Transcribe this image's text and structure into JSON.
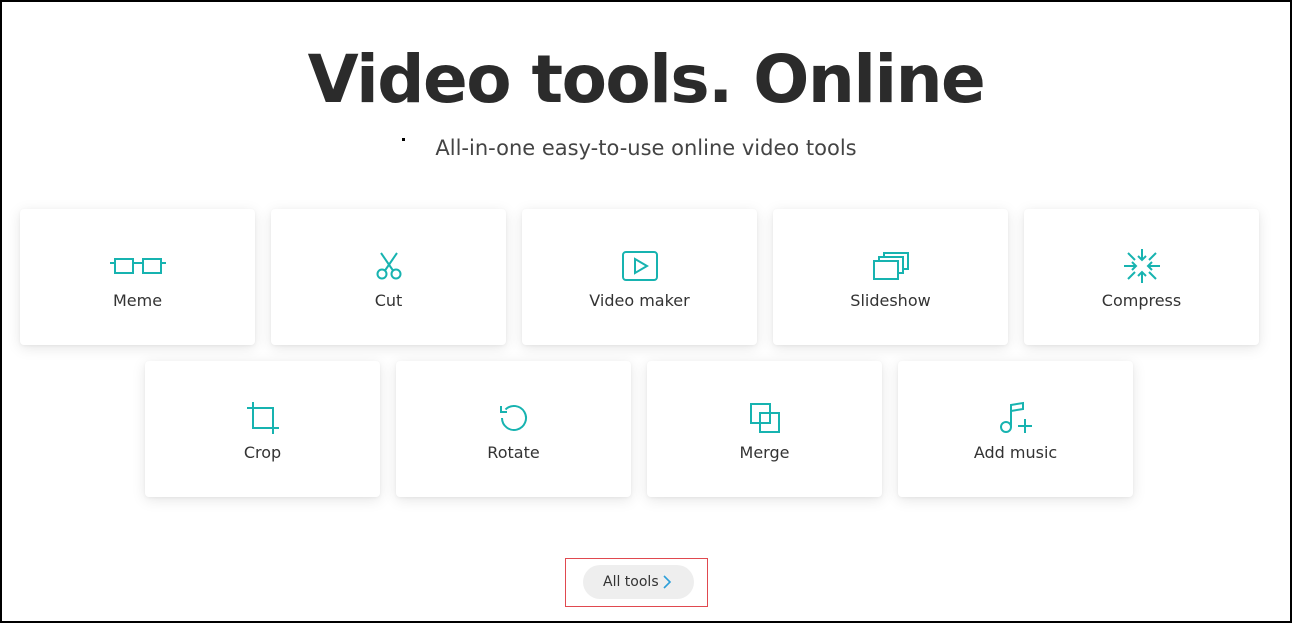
{
  "hero": {
    "title": "Video tools. Online",
    "subtitle": "All-in-one easy-to-use online video tools"
  },
  "tools_row_1": [
    {
      "label": "Meme",
      "icon": "glasses-icon"
    },
    {
      "label": "Cut",
      "icon": "scissors-icon"
    },
    {
      "label": "Video maker",
      "icon": "play-icon"
    },
    {
      "label": "Slideshow",
      "icon": "stacked-frames-icon"
    },
    {
      "label": "Compress",
      "icon": "compress-arrows-icon"
    }
  ],
  "tools_row_2": [
    {
      "label": "Crop",
      "icon": "crop-icon"
    },
    {
      "label": "Rotate",
      "icon": "rotate-icon"
    },
    {
      "label": "Merge",
      "icon": "merge-icon"
    },
    {
      "label": "Add music",
      "icon": "music-add-icon"
    }
  ],
  "all_tools": {
    "label": "All tools",
    "icon": "chevron-right-icon"
  },
  "colors": {
    "accent": "#17b3b0",
    "chevron": "#2d9fd9",
    "highlight_box": "#e0494f"
  }
}
